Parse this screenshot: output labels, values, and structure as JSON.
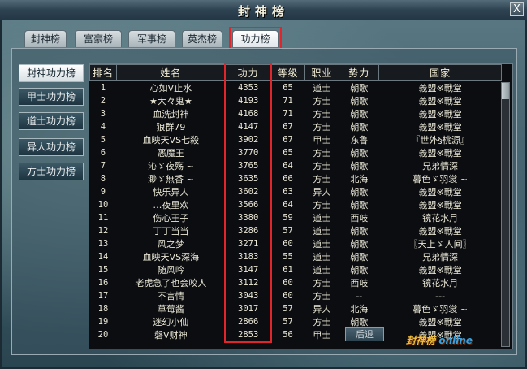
{
  "window": {
    "title": "封神榜",
    "close_label": "X"
  },
  "tabs": [
    {
      "label": "封神榜"
    },
    {
      "label": "富豪榜"
    },
    {
      "label": "军事榜"
    },
    {
      "label": "英杰榜"
    },
    {
      "label": "功力榜",
      "active": true
    }
  ],
  "side_buttons": [
    {
      "label": "封神功力榜",
      "active": true
    },
    {
      "label": "甲士功力榜"
    },
    {
      "label": "道士功力榜"
    },
    {
      "label": "异人功力榜"
    },
    {
      "label": "方士功力榜"
    }
  ],
  "table": {
    "headers": [
      "排名",
      "姓名",
      "功力",
      "等级",
      "职业",
      "势力",
      "国家"
    ],
    "rows": [
      [
        "1",
        "心如V止水",
        "4353",
        "65",
        "道士",
        "朝歌",
        "義盟※戰堂"
      ],
      [
        "2",
        "★大々鬼★",
        "4193",
        "71",
        "方士",
        "朝歌",
        "義盟※戰堂"
      ],
      [
        "3",
        "血洗封神",
        "4168",
        "71",
        "方士",
        "朝歌",
        "義盟※戰堂"
      ],
      [
        "4",
        "狼群79",
        "4147",
        "67",
        "方士",
        "朝歌",
        "義盟※戰堂"
      ],
      [
        "5",
        "血映天VS七殺",
        "3902",
        "67",
        "甲士",
        "东鲁",
        "『世外§桃源』"
      ],
      [
        "6",
        "恶魔王",
        "3770",
        "65",
        "方士",
        "朝歌",
        "義盟※戰堂"
      ],
      [
        "7",
        "沁ゞ夜殇 ~",
        "3765",
        "64",
        "方士",
        "朝歌",
        "兄弟情深"
      ],
      [
        "8",
        "渺ゞ無香 ~",
        "3635",
        "66",
        "方士",
        "北海",
        "暮色ゞ羽裳 ~"
      ],
      [
        "9",
        "快乐异人",
        "3602",
        "63",
        "异人",
        "朝歌",
        "義盟※戰堂"
      ],
      [
        "10",
        "…夜里欢",
        "3566",
        "64",
        "方士",
        "朝歌",
        "義盟※戰堂"
      ],
      [
        "11",
        "伤心王子",
        "3380",
        "59",
        "道士",
        "西岐",
        "镜花水月"
      ],
      [
        "12",
        "丁丁当当",
        "3286",
        "57",
        "道士",
        "朝歌",
        "義盟※戰堂"
      ],
      [
        "13",
        "风之梦",
        "3271",
        "60",
        "道士",
        "朝歌",
        "〖天上ゞ人间〗"
      ],
      [
        "14",
        "血映天VS深海",
        "3183",
        "55",
        "道士",
        "朝歌",
        "兄弟情深"
      ],
      [
        "15",
        "随风吟",
        "3147",
        "61",
        "道士",
        "朝歌",
        "義盟※戰堂"
      ],
      [
        "16",
        "老虎急了也会咬人",
        "3112",
        "60",
        "方士",
        "西岐",
        "镜花水月"
      ],
      [
        "17",
        "不言情",
        "3043",
        "60",
        "方士",
        "--",
        "---"
      ],
      [
        "18",
        "草莓酱",
        "3017",
        "57",
        "异人",
        "北海",
        "暮色ゞ羽裳 ~"
      ],
      [
        "19",
        "迷幻小仙",
        "2866",
        "57",
        "方士",
        "朝歌",
        "義盟※戰堂"
      ],
      [
        "20",
        "磐V财神",
        "2853",
        "56",
        "甲士",
        "朝歌",
        "義盟※戰堂"
      ]
    ]
  },
  "footer": {
    "back_label": "后退",
    "logo_text": "封神榜",
    "logo_text_b": "online"
  }
}
